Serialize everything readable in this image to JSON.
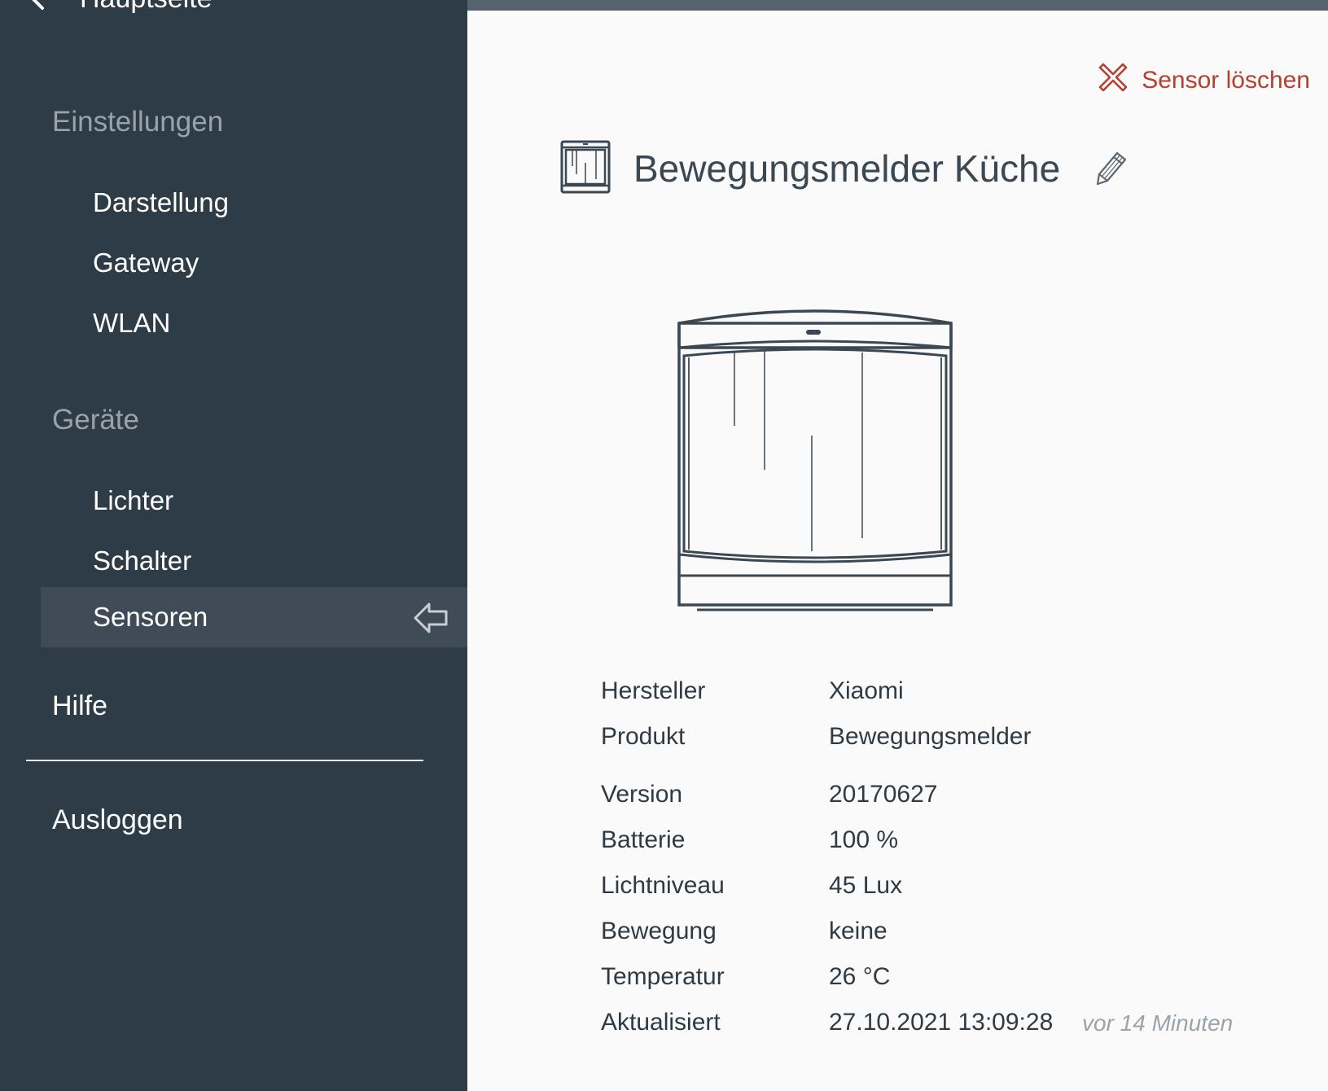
{
  "sidebar": {
    "back_link": {
      "label": "Hauptseite",
      "icon": "arrow-left-icon"
    },
    "sections": [
      {
        "heading": "Einstellungen",
        "items": [
          {
            "label": "Darstellung"
          },
          {
            "label": "Gateway"
          },
          {
            "label": "WLAN"
          }
        ]
      },
      {
        "heading": "Geräte",
        "items": [
          {
            "label": "Lichter"
          },
          {
            "label": "Schalter"
          },
          {
            "label": "Sensoren",
            "active": true,
            "icon": "arrow-left-outline-icon"
          }
        ]
      }
    ],
    "help_label": "Hilfe",
    "logout_label": "Ausloggen"
  },
  "header": {
    "delete_label": "Sensor löschen",
    "delete_icon": "close-cross-icon",
    "delete_color": "#b5402f"
  },
  "device": {
    "name": "Bewegungsmelder Küche",
    "icon": "motion-sensor-icon",
    "edit_icon": "pencil-icon",
    "image": "motion-sensor-image"
  },
  "details": [
    {
      "label": "Hersteller",
      "value": "Xiaomi"
    },
    {
      "label": "Produkt",
      "value": "Bewegungsmelder"
    },
    {
      "label": "Version",
      "value": "20170627"
    },
    {
      "label": "Batterie",
      "value": "100 %"
    },
    {
      "label": "Lichtniveau",
      "value": "45 Lux"
    },
    {
      "label": "Bewegung",
      "value": "keine"
    },
    {
      "label": "Temperatur",
      "value": "26 °C"
    },
    {
      "label": "Aktualisiert",
      "value": "27.10.2021 13:09:28",
      "relative": "vor 14 Minuten"
    }
  ],
  "colors": {
    "sidebar_bg": "#2e3c47",
    "sidebar_active_bg": "#3f4c58",
    "content_bg": "#fafafa",
    "section_heading": "#9aa3aa"
  }
}
